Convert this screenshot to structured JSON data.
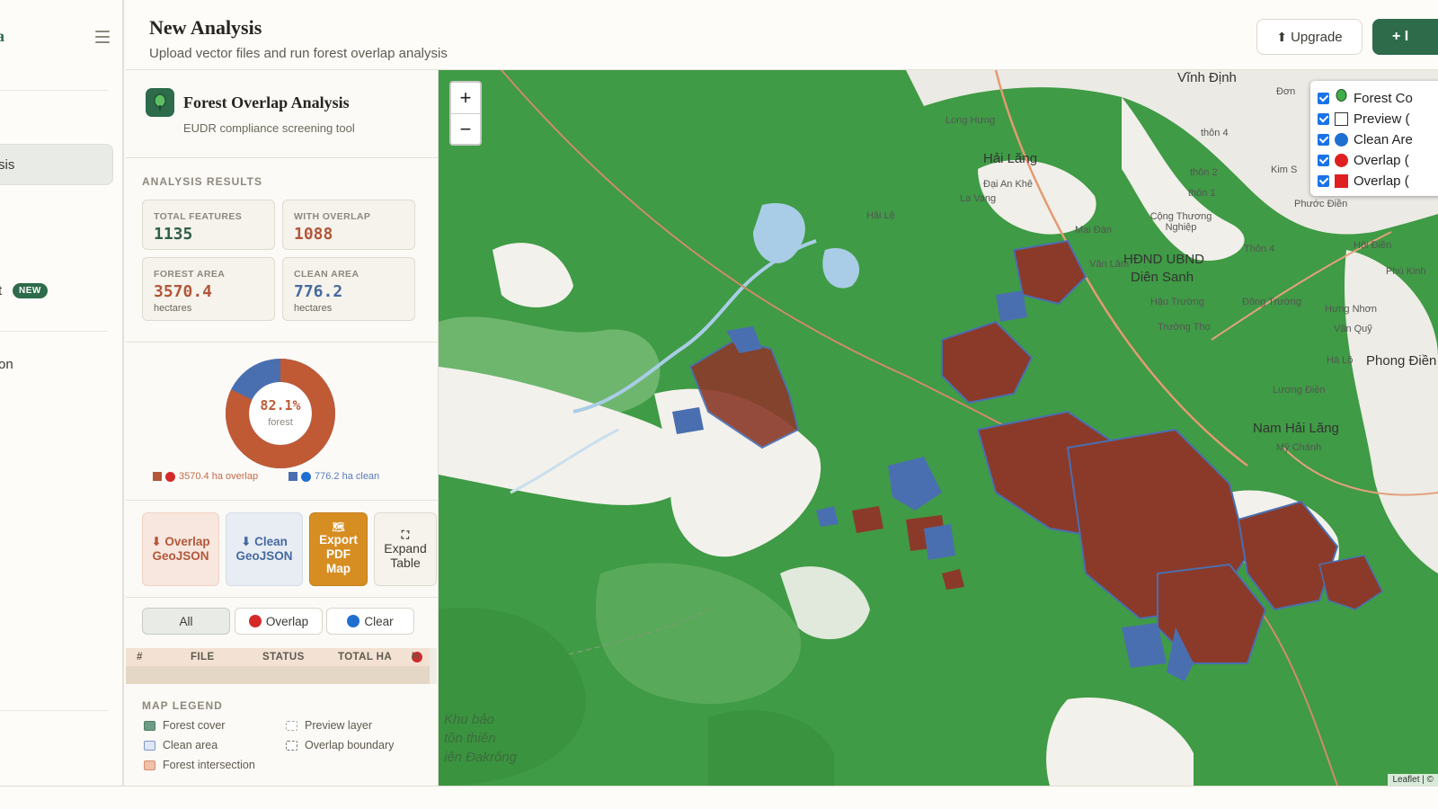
{
  "sidebar": {
    "logo_fragment": "a",
    "active_item_fragment": "sis",
    "item2_fragment": "t",
    "new_badge": "NEW",
    "item3_fragment": "on"
  },
  "header": {
    "title": "New Analysis",
    "subtitle": "Upload vector files and run forest overlap analysis",
    "upgrade_label": "Upgrade",
    "new_label": "+ I"
  },
  "panel": {
    "title": "Forest Overlap Analysis",
    "subtitle": "EUDR compliance screening tool",
    "results_label": "ANALYSIS RESULTS",
    "stats": {
      "total_features": {
        "label": "TOTAL FEATURES",
        "value": "1135"
      },
      "with_overlap": {
        "label": "WITH OVERLAP",
        "value": "1088"
      },
      "forest_area": {
        "label": "FOREST AREA",
        "value": "3570.4",
        "unit": "hectares"
      },
      "clean_area": {
        "label": "CLEAN AREA",
        "value": "776.2",
        "unit": "hectares"
      }
    },
    "donut": {
      "percent_text": "82.1%",
      "sub_text": "forest",
      "forest_fraction": 0.821,
      "legend_overlap": "3570.4 ha overlap",
      "legend_clean": "776.2 ha clean"
    },
    "actions": {
      "overlap": "⬇ Overlap GeoJSON",
      "clean": "⬇ Clean GeoJSON",
      "pdf": "Export PDF Map",
      "expand": "Expand Table"
    },
    "filters": {
      "all": "All",
      "overlap": "Overlap",
      "clear": "Clear"
    },
    "table_columns": [
      "#",
      "FILE",
      "STATUS",
      "TOTAL HA",
      "H"
    ],
    "legend_label": "MAP LEGEND",
    "legend_items": {
      "forest_cover": "Forest cover",
      "clean_area": "Clean area",
      "forest_intersection": "Forest intersection",
      "preview_layer": "Preview layer",
      "overlap_boundary": "Overlap boundary"
    }
  },
  "map": {
    "zoom_in": "+",
    "zoom_out": "−",
    "layers": [
      "Forest Co",
      "Preview (",
      "Clean Are",
      "Overlap (",
      "Overlap ("
    ],
    "labels": {
      "vinh_dinh": "Vĩnh Định",
      "hai_lang": "Hải Lăng",
      "hdnd": "HĐND UBND",
      "dien_sanh": "Diên Sanh",
      "phong_dien": "Phong Điền",
      "nam_hai_lang": "Nam Hải Lăng",
      "long_hung": "Long Hưng",
      "dai_an_khe": "Đại An Khê",
      "la_vang": "La Vang",
      "hai_le": "Hải Lệ",
      "mai_dan": "Mai Đàn",
      "cong_thuong_nghiep": "Cộng Thương Nghiệp",
      "thon4": "thôn 4",
      "thon2": "thôn 2",
      "thon1": "thôn 1",
      "thon_4b": "Thôn 4",
      "phuoc_dien": "Phước Điền",
      "hoi_dien": "Hội Điền",
      "phu_kinh": "Phú Kinh",
      "dong_truong": "Đông Trường",
      "hung_nhon": "Hưng Nhơn",
      "van_quy": "Vân Quỹ",
      "ha_lo": "Hà Lộ",
      "luong_dien": "Lương Điền",
      "my_chanh": "Mỹ Chánh",
      "khu_bao_ton": "Khu bảo",
      "khu_bao_ton2": "tồn thiên",
      "khu_bao_ton3": "iên Đakrông",
      "hau_truong": "Hậu Trường",
      "truong_tho": "Trường Thọ",
      "don": "Đơn",
      "kim_s": "Kim S",
      "van_lam": "Văn Lâm"
    },
    "attribution": "Leaflet | ©"
  },
  "colors": {
    "brand_green": "#2d6b4a",
    "forest": "#3f9b45",
    "overlap": "#8b3a2a",
    "clean": "#4a6fb0",
    "pdf_orange": "#d68e23"
  }
}
